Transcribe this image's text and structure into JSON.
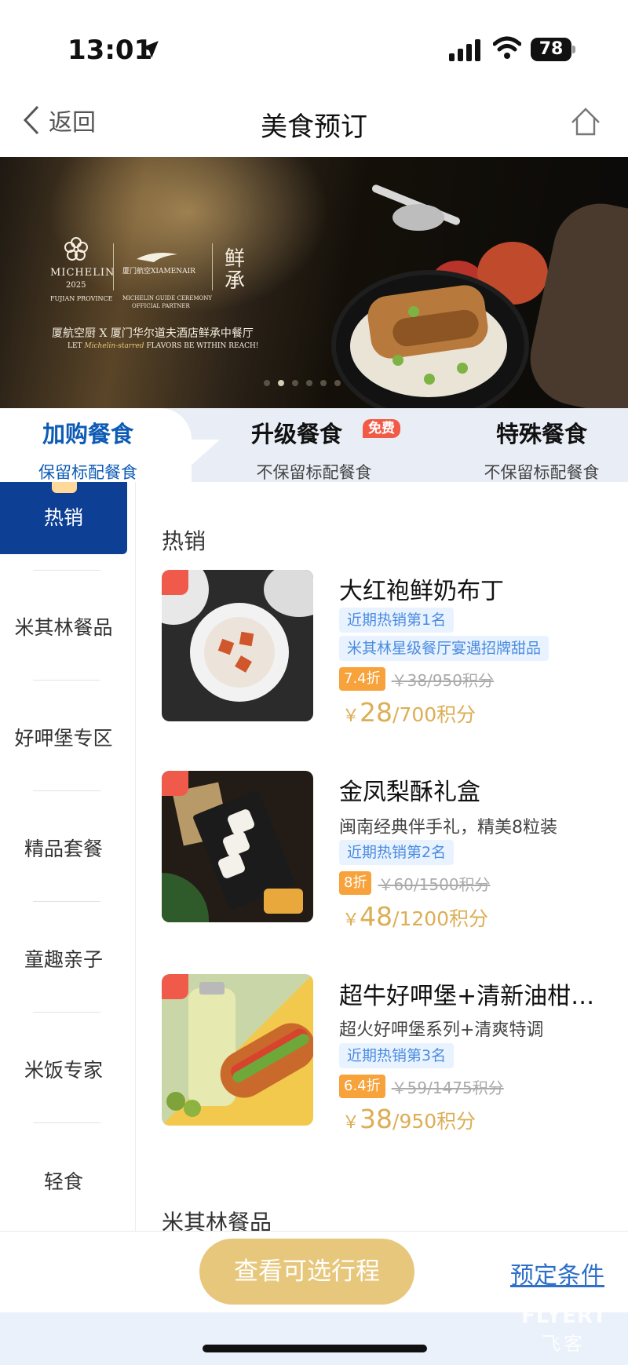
{
  "status_bar": {
    "time": "13:01",
    "battery": "78"
  },
  "nav": {
    "back_label": "返回",
    "title": "美食预订"
  },
  "banner": {
    "michelin_word": "MICHELIN",
    "michelin_year": "2025",
    "michelin_region": "FUJIAN PROVINCE",
    "airline": "厦门航空XIAMENAIR",
    "guide_line1": "MICHELIN GUIDE CEREMONY",
    "guide_line2": "OFFICIAL PARTNER",
    "restaurant_logo": "鲜承",
    "headline": "厦航空厨 X 厦门华尔道夫酒店鲜承中餐厅",
    "subline_pre": "LET ",
    "subline_italic": "Michelin-starred",
    "subline_post": " FLAVORS BE WITHIN REACH!",
    "slide_count": 6,
    "active_slide": 2
  },
  "tabs": [
    {
      "name": "加购餐食",
      "sub": "保留标配餐食",
      "active": true
    },
    {
      "name": "升级餐食",
      "sub": "不保留标配餐食",
      "badge": "免费"
    },
    {
      "name": "特殊餐食",
      "sub": "不保留标配餐食"
    }
  ],
  "sidebar": [
    {
      "label": "热销",
      "active": true
    },
    {
      "label": "米其林餐品"
    },
    {
      "label": "好呷堡专区"
    },
    {
      "label": "精品套餐"
    },
    {
      "label": "童趣亲子"
    },
    {
      "label": "米饭专家"
    },
    {
      "label": "轻食"
    }
  ],
  "sections": {
    "hot": "热销",
    "michelin": "米其林餐品"
  },
  "products": [
    {
      "name": "大红袍鲜奶布丁",
      "desc": "",
      "tags": [
        "近期热销第1名",
        "米其林星级餐厅宴遇招牌甜品"
      ],
      "discount": "7.4折",
      "original": "￥38/950积分",
      "currency": "￥",
      "price": "28",
      "points": "/700积分"
    },
    {
      "name": "金凤梨酥礼盒",
      "desc": "闽南经典伴手礼，精美8粒装",
      "tags": [
        "近期热销第2名"
      ],
      "discount": "8折",
      "original": "￥60/1500积分",
      "currency": "￥",
      "price": "48",
      "points": "/1200积分"
    },
    {
      "name": "超牛好呷堡+清新油柑…",
      "desc": "超火好呷堡系列+清爽特调",
      "tags": [
        "近期热销第3名"
      ],
      "discount": "6.4折",
      "original": "￥59/1475积分",
      "currency": "￥",
      "price": "38",
      "points": "/950积分"
    }
  ],
  "bottom": {
    "cta": "查看可选行程",
    "terms": "预定条件"
  },
  "watermark": {
    "line1": "FLYERT",
    "line2": "飞客"
  },
  "colors": {
    "primary_blue": "#0d3f95",
    "gold": "#dcae55",
    "cta_gold": "#e7c77c",
    "discount_orange": "#f7a23a",
    "badge_red": "#f25a48",
    "link_blue": "#2e6fc7",
    "tag_blue": "#4a8be0"
  }
}
